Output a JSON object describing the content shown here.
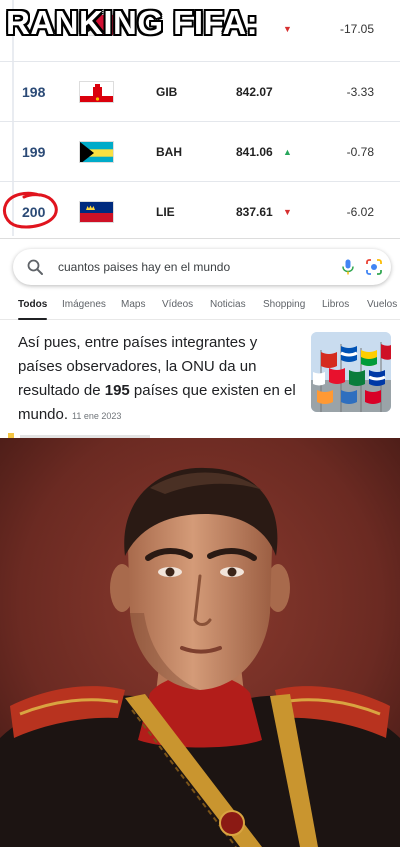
{
  "meme": {
    "title": "RANKING FIFA:"
  },
  "ranking": {
    "rows": [
      {
        "position": "",
        "code": "",
        "points": "",
        "trend": "down",
        "change": "-17.05"
      },
      {
        "position": "198",
        "code": "GIB",
        "points": "842.07",
        "trend": "",
        "change": "-3.33"
      },
      {
        "position": "199",
        "code": "BAH",
        "points": "841.06",
        "trend": "up",
        "change": "-0.78"
      },
      {
        "position": "200",
        "code": "LIE",
        "points": "837.61",
        "trend": "down",
        "change": "-6.02"
      }
    ]
  },
  "search": {
    "query": "cuantos paises hay en el mundo",
    "tabs": [
      "Todos",
      "Imágenes",
      "Maps",
      "Vídeos",
      "Noticias",
      "Shopping",
      "Libros",
      "Vuelos"
    ],
    "snippet_before": "Así pues, entre países integrantes y países observadores, la ONU da un resultado de ",
    "snippet_highlight": "195",
    "snippet_after": " países que existen en el mundo.",
    "snippet_date": "11 ene 2023"
  },
  "colors": {
    "rank_number": "#2b4a76",
    "trend_up": "#26a65b",
    "trend_down": "#d63030",
    "annotation_circle": "#e0141e"
  },
  "icons": {
    "trend_up": "triangle-up-icon",
    "trend_down": "triangle-down-icon",
    "search": "search-icon",
    "voice": "microphone-icon",
    "lens": "google-lens-icon"
  }
}
